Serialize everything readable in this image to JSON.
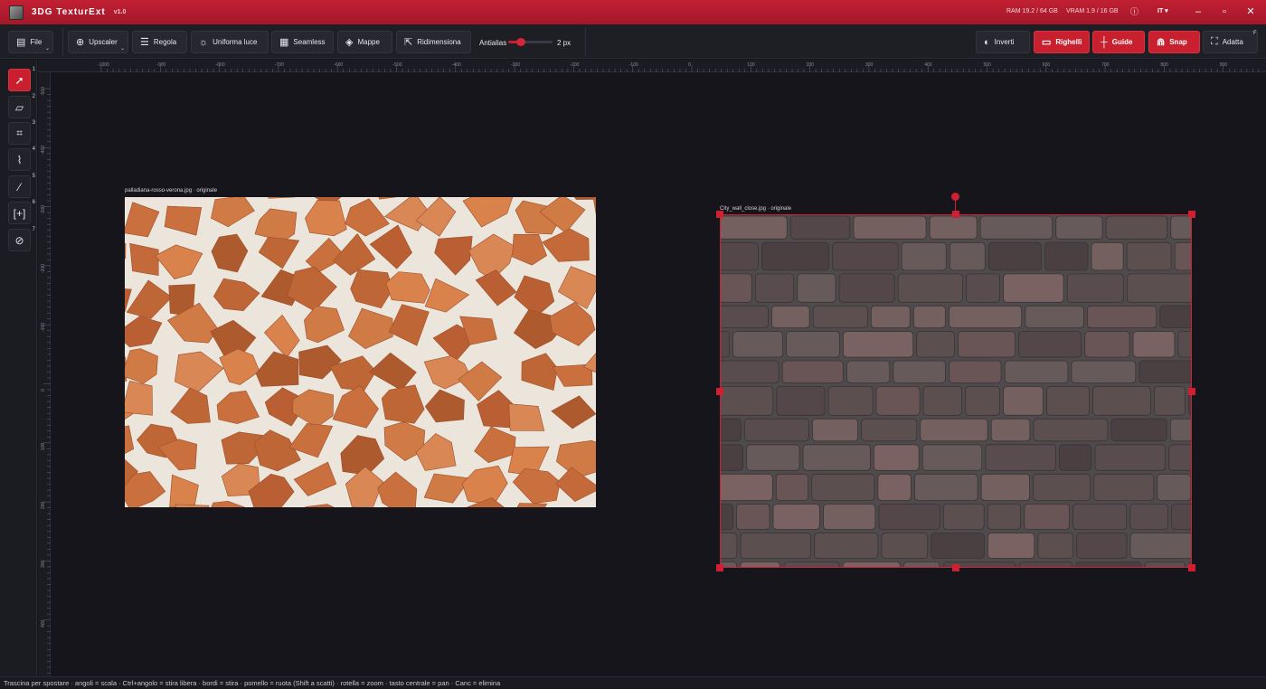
{
  "app": {
    "title": "3DG TexturExt",
    "version": "v1.0",
    "ram": "RAM 19.2 / 64 GB",
    "vram": "VRAM 1.9 / 16 GB",
    "language": "IT ▾"
  },
  "toolbar": {
    "file": "File",
    "upscaler": "Upscaler",
    "regola": "Regola",
    "uniforma_luce": "Uniforma luce",
    "seamless": "Seamless",
    "mappe": "Mappe",
    "ridimensiona": "Ridimensiona",
    "antialias_label": "Antialias",
    "antialias_value": "2 px",
    "antialias_fraction": 0.32,
    "inverti": "Inverti",
    "righelli": "Righelli",
    "guide": "Guide",
    "snap": "Snap",
    "adatta": "Adatta",
    "adatta_shortcut": "F"
  },
  "tools": [
    {
      "name": "select-tool",
      "icon": "cursor-arrow-icon",
      "shortcut": "1",
      "active": true
    },
    {
      "name": "transform-tool",
      "icon": "transform-icon",
      "shortcut": "2",
      "active": false
    },
    {
      "name": "crop-tool",
      "icon": "crop-icon",
      "shortcut": "3",
      "active": false
    },
    {
      "name": "warp-tool",
      "icon": "warp-icon",
      "shortcut": "4",
      "active": false
    },
    {
      "name": "magic-wand-tool",
      "icon": "magic-wand-icon",
      "shortcut": "5",
      "active": false
    },
    {
      "name": "fit-tool",
      "icon": "bracket-plus-icon",
      "shortcut": "6",
      "active": false
    },
    {
      "name": "patch-tool",
      "icon": "bandage-icon",
      "shortcut": "7",
      "active": false
    }
  ],
  "ruler_top": [
    "-1000",
    "-900",
    "-800",
    "-700",
    "-600",
    "-500",
    "-400",
    "-300",
    "-200",
    "-100",
    "0",
    "100",
    "200",
    "300",
    "400",
    "500",
    "600",
    "700",
    "800",
    "900"
  ],
  "ruler_left": [
    "-500",
    "-400",
    "-300",
    "-200",
    "-100",
    "0",
    "100",
    "200",
    "300",
    "400",
    "500"
  ],
  "images": [
    {
      "caption": "palladiana-rosso-verona.jpg · originale"
    },
    {
      "caption": "City_wall_close.jpg · originale"
    }
  ],
  "colors": {
    "accent": "#c8202f",
    "background": "#15151b"
  },
  "status": "Trascina per spostare · angoli = scala · Ctrl+angolo = stira libera · bordi = stira · pomello = ruota (Shift a scatti) · rotella = zoom · tasto centrale = pan · Canc = elimina"
}
